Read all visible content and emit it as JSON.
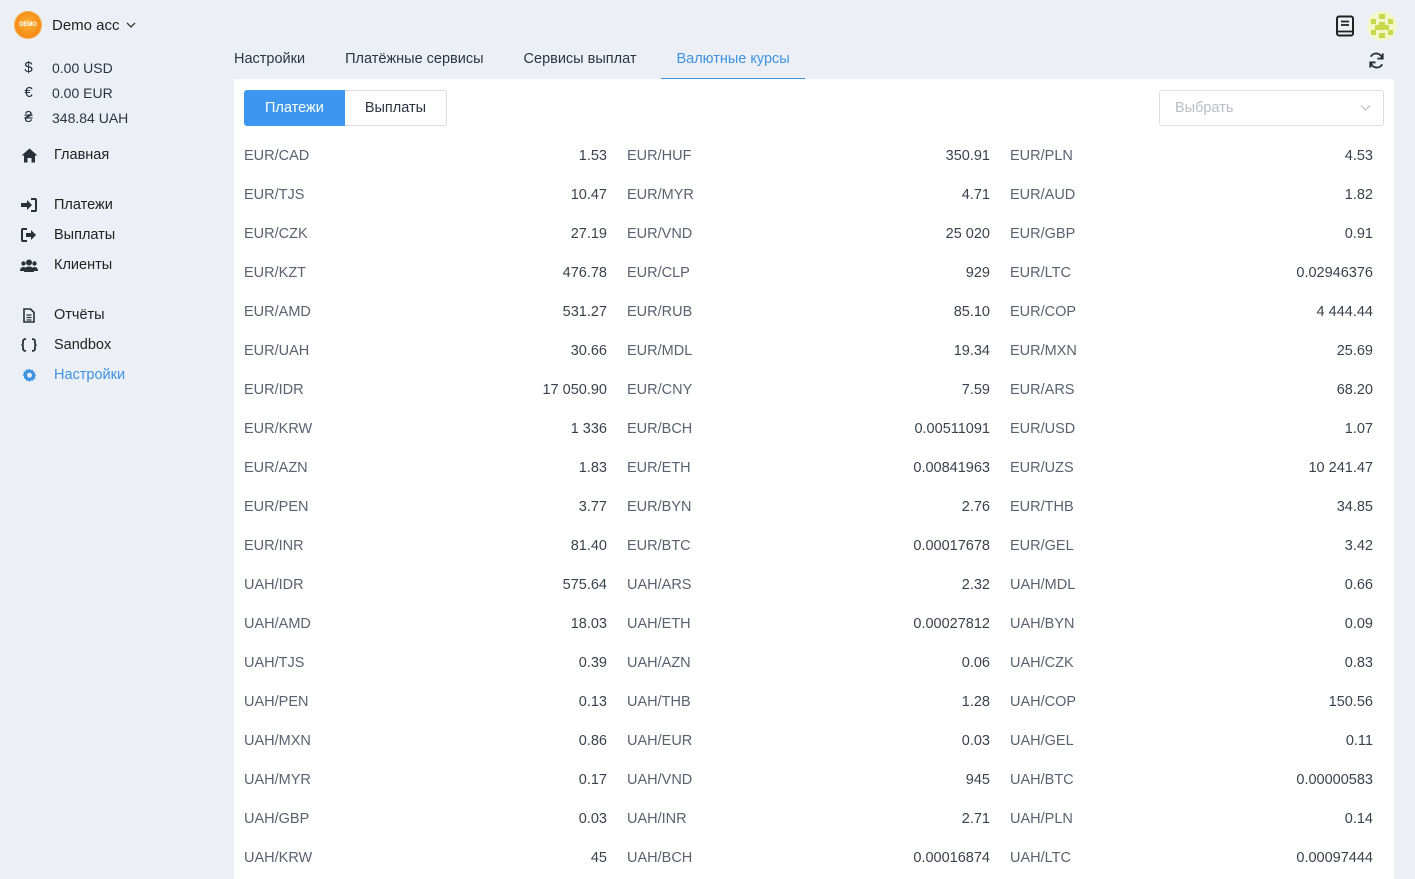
{
  "account": {
    "logo_text": "DEMO",
    "name": "Demo acc"
  },
  "balances": [
    {
      "symbol": "$",
      "amount": "0.00 USD"
    },
    {
      "symbol": "€",
      "amount": "0.00 EUR"
    },
    {
      "symbol": "₴",
      "amount": "348.84 UAH"
    }
  ],
  "nav": {
    "home": "Главная",
    "payments": "Платежи",
    "payouts": "Выплаты",
    "clients": "Клиенты",
    "reports": "Отчёты",
    "sandbox": "Sandbox",
    "settings": "Настройки"
  },
  "tabs": {
    "settings": "Настройки",
    "payment_services": "Платёжные сервисы",
    "payout_services": "Сервисы выплат",
    "currency_rates": "Валютные курсы"
  },
  "segment": {
    "payments": "Платежи",
    "payouts": "Выплаты"
  },
  "select": {
    "placeholder": "Выбрать"
  },
  "colors": {
    "accent": "#3d93e2",
    "button_active": "#3d97f0",
    "background": "#eceff5"
  },
  "rates": [
    [
      [
        "EUR/CAD",
        "1.53"
      ],
      [
        "EUR/HUF",
        "350.91"
      ],
      [
        "EUR/PLN",
        "4.53"
      ]
    ],
    [
      [
        "EUR/TJS",
        "10.47"
      ],
      [
        "EUR/MYR",
        "4.71"
      ],
      [
        "EUR/AUD",
        "1.82"
      ]
    ],
    [
      [
        "EUR/CZK",
        "27.19"
      ],
      [
        "EUR/VND",
        "25 020"
      ],
      [
        "EUR/GBP",
        "0.91"
      ]
    ],
    [
      [
        "EUR/KZT",
        "476.78"
      ],
      [
        "EUR/CLP",
        "929"
      ],
      [
        "EUR/LTC",
        "0.02946376"
      ]
    ],
    [
      [
        "EUR/AMD",
        "531.27"
      ],
      [
        "EUR/RUB",
        "85.10"
      ],
      [
        "EUR/COP",
        "4 444.44"
      ]
    ],
    [
      [
        "EUR/UAH",
        "30.66"
      ],
      [
        "EUR/MDL",
        "19.34"
      ],
      [
        "EUR/MXN",
        "25.69"
      ]
    ],
    [
      [
        "EUR/IDR",
        "17 050.90"
      ],
      [
        "EUR/CNY",
        "7.59"
      ],
      [
        "EUR/ARS",
        "68.20"
      ]
    ],
    [
      [
        "EUR/KRW",
        "1 336"
      ],
      [
        "EUR/BCH",
        "0.00511091"
      ],
      [
        "EUR/USD",
        "1.07"
      ]
    ],
    [
      [
        "EUR/AZN",
        "1.83"
      ],
      [
        "EUR/ETH",
        "0.00841963"
      ],
      [
        "EUR/UZS",
        "10 241.47"
      ]
    ],
    [
      [
        "EUR/PEN",
        "3.77"
      ],
      [
        "EUR/BYN",
        "2.76"
      ],
      [
        "EUR/THB",
        "34.85"
      ]
    ],
    [
      [
        "EUR/INR",
        "81.40"
      ],
      [
        "EUR/BTC",
        "0.00017678"
      ],
      [
        "EUR/GEL",
        "3.42"
      ]
    ],
    [
      [
        "UAH/IDR",
        "575.64"
      ],
      [
        "UAH/ARS",
        "2.32"
      ],
      [
        "UAH/MDL",
        "0.66"
      ]
    ],
    [
      [
        "UAH/AMD",
        "18.03"
      ],
      [
        "UAH/ETH",
        "0.00027812"
      ],
      [
        "UAH/BYN",
        "0.09"
      ]
    ],
    [
      [
        "UAH/TJS",
        "0.39"
      ],
      [
        "UAH/AZN",
        "0.06"
      ],
      [
        "UAH/CZK",
        "0.83"
      ]
    ],
    [
      [
        "UAH/PEN",
        "0.13"
      ],
      [
        "UAH/THB",
        "1.28"
      ],
      [
        "UAH/COP",
        "150.56"
      ]
    ],
    [
      [
        "UAH/MXN",
        "0.86"
      ],
      [
        "UAH/EUR",
        "0.03"
      ],
      [
        "UAH/GEL",
        "0.11"
      ]
    ],
    [
      [
        "UAH/MYR",
        "0.17"
      ],
      [
        "UAH/VND",
        "945"
      ],
      [
        "UAH/BTC",
        "0.00000583"
      ]
    ],
    [
      [
        "UAH/GBP",
        "0.03"
      ],
      [
        "UAH/INR",
        "2.71"
      ],
      [
        "UAH/PLN",
        "0.14"
      ]
    ],
    [
      [
        "UAH/KRW",
        "45"
      ],
      [
        "UAH/BCH",
        "0.00016874"
      ],
      [
        "UAH/LTC",
        "0.00097444"
      ]
    ]
  ]
}
